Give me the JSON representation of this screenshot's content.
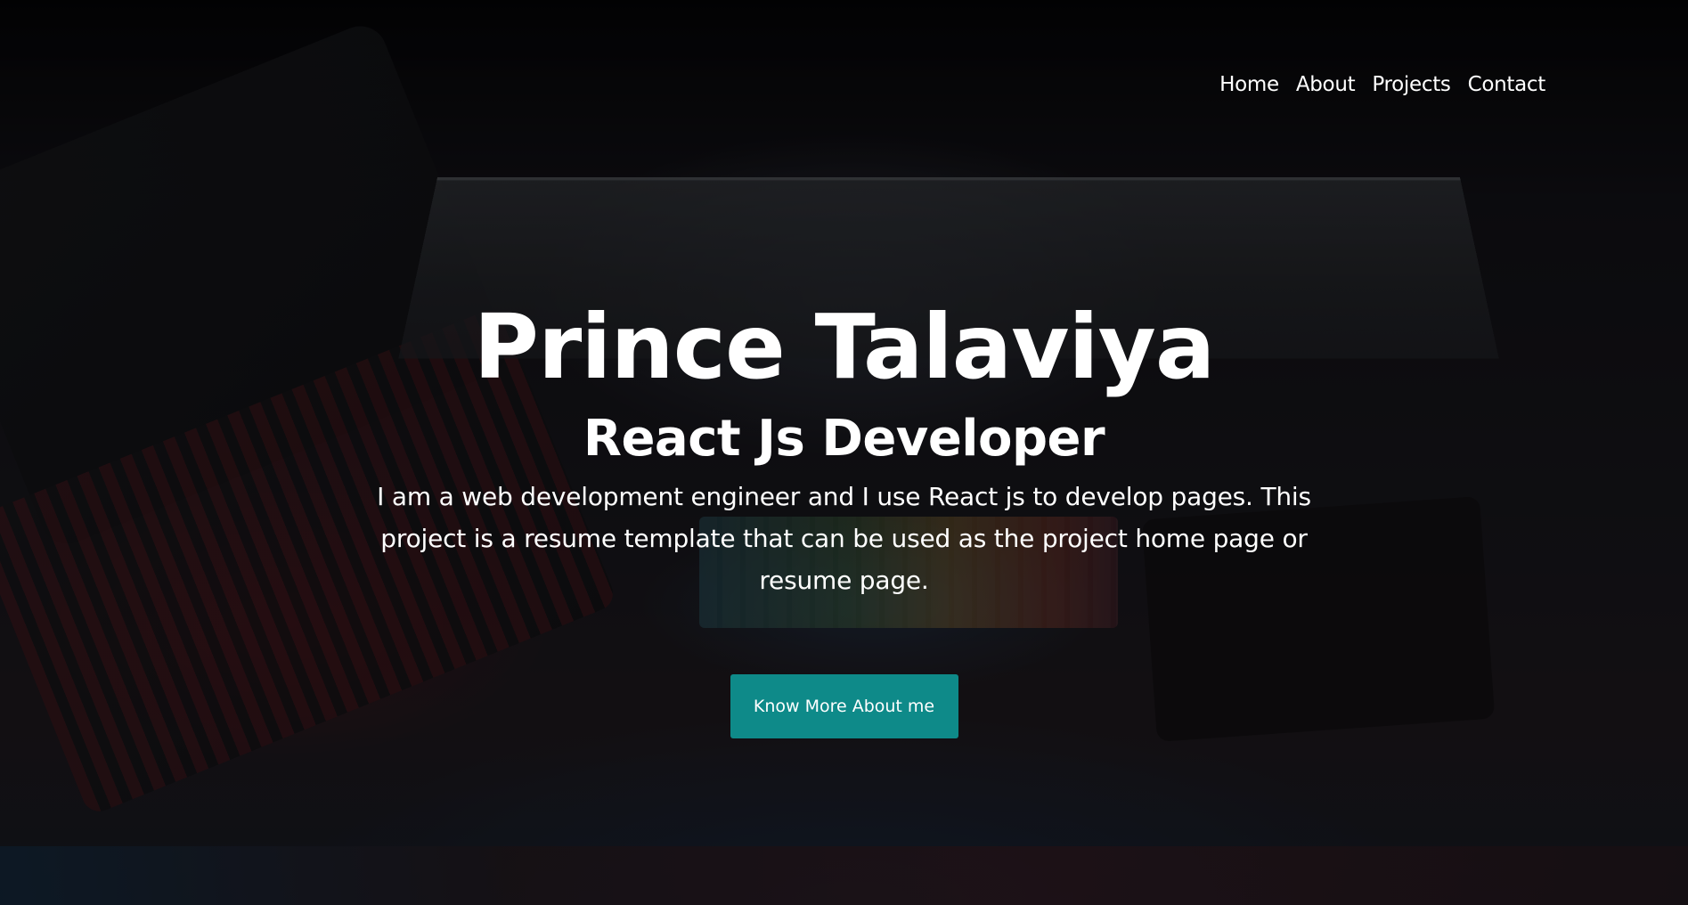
{
  "nav": {
    "items": [
      {
        "label": "Home"
      },
      {
        "label": "About"
      },
      {
        "label": "Projects"
      },
      {
        "label": "Contact"
      }
    ]
  },
  "hero": {
    "name": "Prince Talaviya",
    "role": "React Js Developer",
    "bio": "I am a web development engineer and I use React js to develop pages. This project is a resume template that can be used as the project home page or resume page.",
    "cta_label": "Know More About me"
  },
  "colors": {
    "accent": "#0e8a89",
    "text": "#ffffff"
  }
}
